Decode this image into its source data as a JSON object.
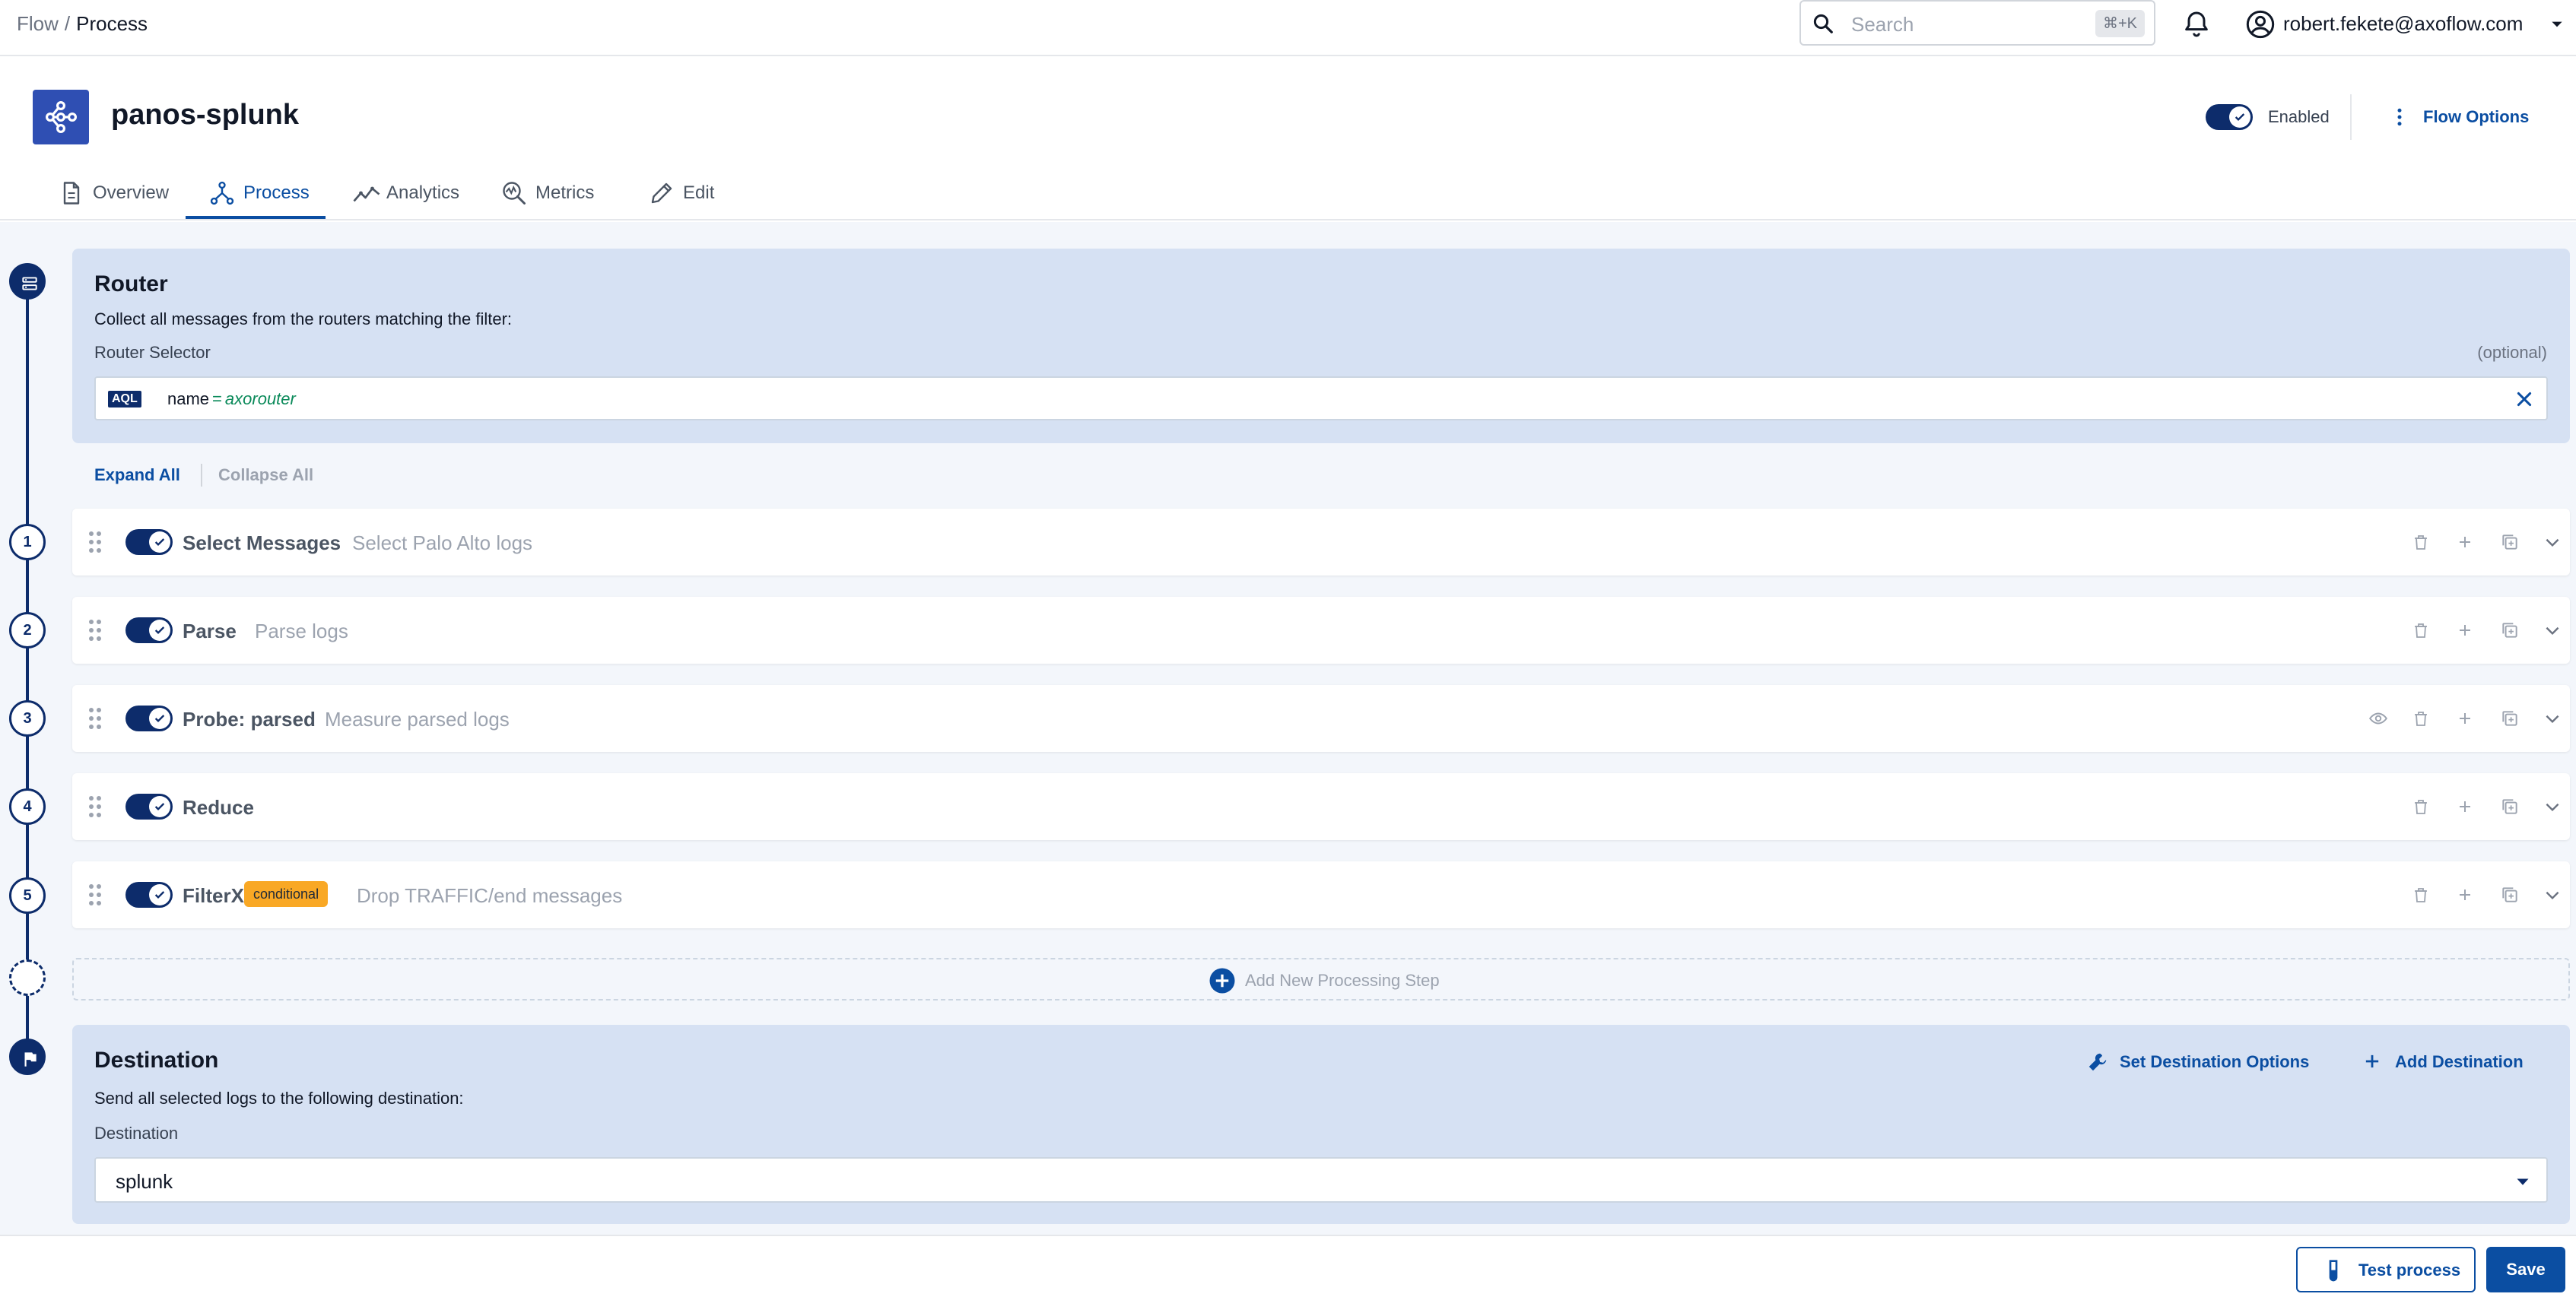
{
  "breadcrumb": {
    "parent": "Flow",
    "separator": "/",
    "current": "Process"
  },
  "search": {
    "placeholder": "Search",
    "shortcut": "⌘+K"
  },
  "user": {
    "email": "robert.fekete@axoflow.com"
  },
  "flow": {
    "name": "panos-splunk",
    "enabled_label": "Enabled",
    "options_label": "Flow Options"
  },
  "tabs": [
    {
      "label": "Overview",
      "icon": "document-icon"
    },
    {
      "label": "Process",
      "icon": "process-icon",
      "active": true
    },
    {
      "label": "Analytics",
      "icon": "analytics-icon"
    },
    {
      "label": "Metrics",
      "icon": "metrics-icon"
    },
    {
      "label": "Edit",
      "icon": "pencil-icon"
    }
  ],
  "router": {
    "title": "Router",
    "description": "Collect all messages from the routers matching the filter:",
    "selector_label": "Router Selector",
    "optional_label": "(optional)",
    "aql_badge": "AQL",
    "query_field": "name",
    "query_operator": "=",
    "query_value": "axorouter"
  },
  "controls": {
    "expand_all": "Expand All",
    "collapse_all": "Collapse All"
  },
  "steps": [
    {
      "number": "1",
      "name": "Select Messages",
      "description": "Select Palo Alto logs",
      "enabled": true
    },
    {
      "number": "2",
      "name": "Parse",
      "description": "Parse logs",
      "enabled": true
    },
    {
      "number": "3",
      "name": "Probe: parsed",
      "description": "Measure parsed logs",
      "enabled": true,
      "has_preview": true
    },
    {
      "number": "4",
      "name": "Reduce",
      "description": "",
      "enabled": true
    },
    {
      "number": "5",
      "name": "FilterX",
      "badge": "conditional",
      "description": "Drop TRAFFIC/end messages",
      "enabled": true
    }
  ],
  "add_step_label": "Add New Processing Step",
  "destination": {
    "title": "Destination",
    "description": "Send all selected logs to the following destination:",
    "label": "Destination",
    "value": "splunk",
    "set_options_label": "Set Destination Options",
    "add_label": "Add Destination"
  },
  "footer": {
    "test_label": "Test process",
    "save_label": "Save"
  },
  "colors": {
    "primary": "#0b4ea2",
    "navy": "#0d2c6b",
    "panel": "#d6e1f3",
    "badge": "#f9a825"
  }
}
